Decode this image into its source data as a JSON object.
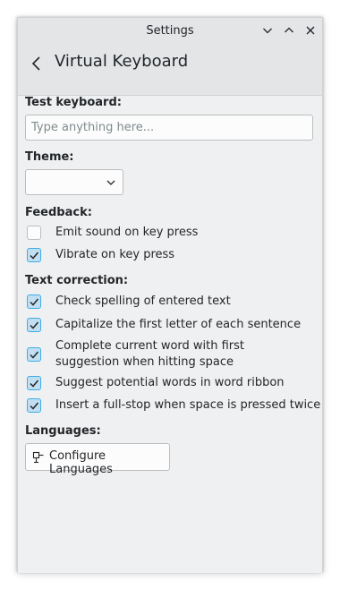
{
  "window": {
    "title": "Settings"
  },
  "header": {
    "title": "Virtual Keyboard"
  },
  "test_keyboard": {
    "label": "Test keyboard:",
    "placeholder": "Type anything here...",
    "value": ""
  },
  "theme": {
    "label": "Theme:",
    "selected": ""
  },
  "feedback": {
    "label": "Feedback:",
    "items": [
      {
        "label": "Emit sound on key press",
        "checked": false
      },
      {
        "label": "Vibrate on key press",
        "checked": true
      }
    ]
  },
  "text_correction": {
    "label": "Text correction:",
    "items": [
      {
        "label": "Check spelling of entered text",
        "checked": true
      },
      {
        "label": "Capitalize the first letter of each sentence",
        "checked": true
      },
      {
        "label": "Complete current word with first suggestion when hitting space",
        "checked": true
      },
      {
        "label": "Suggest potential words in word ribbon",
        "checked": true
      },
      {
        "label": "Insert a full-stop when space is pressed twice",
        "checked": true
      }
    ]
  },
  "languages": {
    "label": "Languages:",
    "button_label": "Configure Languages"
  },
  "icons": {
    "back": "back-arrow-icon",
    "minimize": "chevron-down-icon",
    "maximize": "chevron-up-icon",
    "close": "close-icon",
    "combo": "chevron-down-icon",
    "configure": "plugin-icon",
    "check": "checkmark-icon"
  },
  "colors": {
    "accent": "#3daee9",
    "check_fill": "#c2dff2",
    "window_bg": "#eff0f1",
    "header_bg": "#e3e5e7"
  }
}
